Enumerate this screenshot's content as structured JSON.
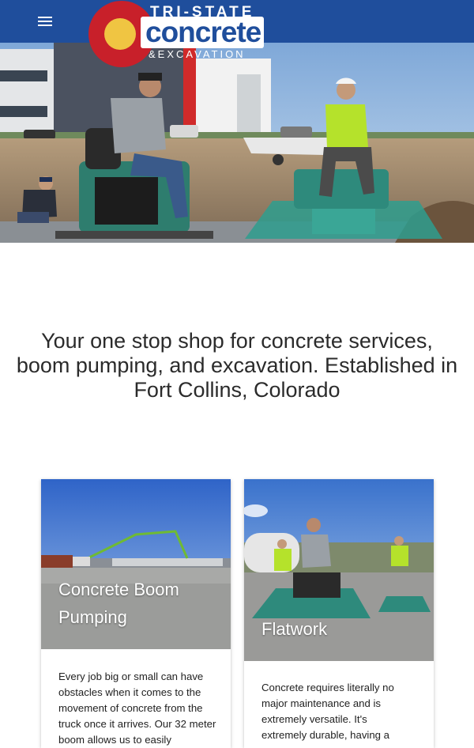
{
  "header": {
    "menu_icon": "hamburger-menu-icon",
    "background_color": "#1f4e9c",
    "logo": {
      "top_text": "TRI-STATE",
      "main_text": "concrete",
      "bottom_text": "&EXCAVATION",
      "flag_red": "#c8202a",
      "flag_yellow": "#f0c542"
    }
  },
  "hero": {
    "image_description_icon": "concrete-crew-photo"
  },
  "main": {
    "tagline": "Your one stop shop for concrete services, boom pumping, and excavation. Established in Fort Collins, Colorado"
  },
  "cards": [
    {
      "title": "Concrete Boom Pumping",
      "body": "Every job big or small can have obstacles when it comes to the movement of concrete from the truck once it arrives. Our 32 meter boom allows us to easily"
    },
    {
      "title": "Flatwork",
      "body": "Concrete requires literally no major maintenance and is extremely versatile. It's extremely durable, having a"
    }
  ]
}
